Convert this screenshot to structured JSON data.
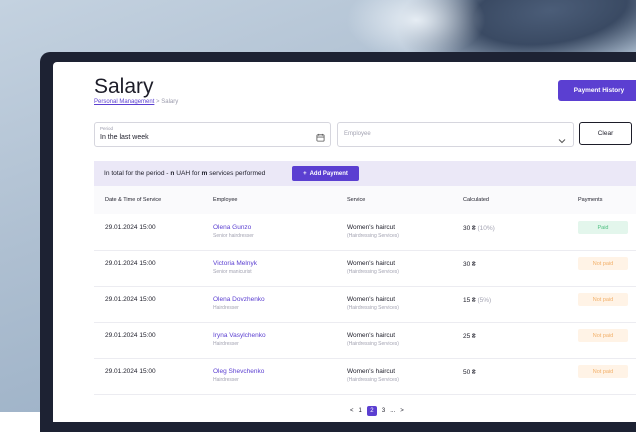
{
  "header": {
    "title": "Salary",
    "breadcrumb_root": "Personal Management",
    "breadcrumb_sep": ">",
    "breadcrumb_current": "Salary",
    "payment_history_label": "Payment History"
  },
  "filters": {
    "period_label": "Period",
    "period_value": "In the last week",
    "employee_placeholder": "Employee",
    "clear_label": "Clear"
  },
  "summary": {
    "prefix": "In total for the period - ",
    "n": "n",
    "middle": " UAH for ",
    "m": "m",
    "suffix": " services performed",
    "add_payment_label": "Add Payment",
    "add_icon": "+"
  },
  "table": {
    "columns": [
      "Date & Time of Service",
      "Employee",
      "Service",
      "Calculated",
      "Payments"
    ],
    "rows": [
      {
        "datetime": "29.01.2024 15:00",
        "employee": "Olena Gunzo",
        "role": "Senior hairdresser",
        "service": "Women's haircut",
        "category": "(Hairdressing Services)",
        "amount": "30 ₴",
        "percent": "(10%)",
        "status": "Paid"
      },
      {
        "datetime": "29.01.2024 15:00",
        "employee": "Victoria Melnyk",
        "role": "Senior manicurist",
        "service": "Women's haircut",
        "category": "(Hairdressing Services)",
        "amount": "30 ₴",
        "percent": "",
        "status": "Not paid"
      },
      {
        "datetime": "29.01.2024 15:00",
        "employee": "Olena Dovzhenko",
        "role": "Hairdresser",
        "service": "Women's haircut",
        "category": "(Hairdressing Services)",
        "amount": "15 ₴",
        "percent": "(5%)",
        "status": "Not paid"
      },
      {
        "datetime": "29.01.2024 15:00",
        "employee": "Iryna Vasylchenko",
        "role": "Hairdresser",
        "service": "Women's haircut",
        "category": "(Hairdressing Services)",
        "amount": "25 ₴",
        "percent": "",
        "status": "Not paid"
      },
      {
        "datetime": "29.01.2024 15:00",
        "employee": "Oleg Shevchenko",
        "role": "Hairdresser",
        "service": "Women's haircut",
        "category": "(Hairdressing Services)",
        "amount": "50 ₴",
        "percent": "",
        "status": "Not paid"
      }
    ]
  },
  "pagination": {
    "prev": "<",
    "pages": [
      "1",
      "2",
      "3"
    ],
    "active": "2",
    "more": "...",
    "next": ">"
  },
  "colors": {
    "accent": "#5b3fd1",
    "paid_bg": "#e3f6ec",
    "paid_text": "#4fbf80",
    "notpaid_bg": "#fff3e6",
    "notpaid_text": "#f2b06a"
  }
}
